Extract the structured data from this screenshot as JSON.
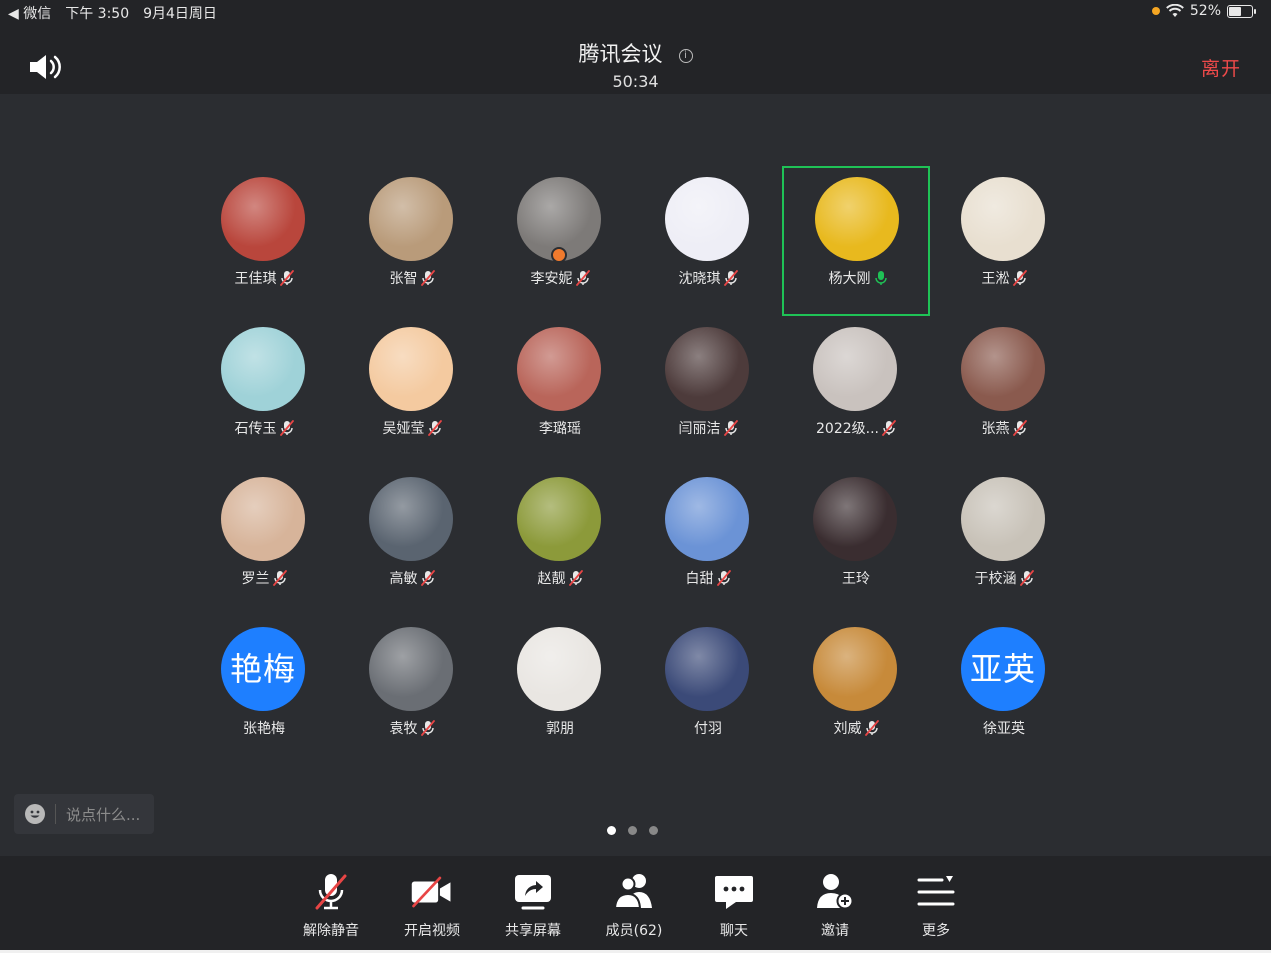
{
  "status_bar": {
    "back_app": "◀ 微信",
    "time": "下午 3:50",
    "date": "9月4日周日",
    "battery": "52%"
  },
  "header": {
    "title": "腾讯会议",
    "info_icon": "i",
    "timer": "50:34",
    "leave_label": "离开"
  },
  "participants": [
    {
      "name": "王佳琪",
      "mic": "muted",
      "avatar": "photo",
      "color": "#b9463c"
    },
    {
      "name": "张智",
      "mic": "muted",
      "avatar": "photo",
      "color": "#b99b7a"
    },
    {
      "name": "李安妮",
      "mic": "muted",
      "avatar": "photo",
      "color": "#7d7a78"
    },
    {
      "name": "沈晓琪",
      "mic": "muted",
      "avatar": "photo",
      "color": "#eeeef6"
    },
    {
      "name": "杨大刚",
      "mic": "active",
      "avatar": "photo",
      "color": "#e8b91e"
    },
    {
      "name": "王淞",
      "mic": "muted",
      "avatar": "photo",
      "color": "#e8dfd0"
    },
    {
      "name": "石传玉",
      "mic": "muted",
      "avatar": "photo",
      "color": "#9fd2d8"
    },
    {
      "name": "吴娅莹",
      "mic": "muted",
      "avatar": "photo",
      "color": "#f4caa0"
    },
    {
      "name": "李璐瑶",
      "mic": "none",
      "avatar": "photo",
      "color": "#b9655a"
    },
    {
      "name": "闫丽洁",
      "mic": "muted",
      "avatar": "photo",
      "color": "#4d3b3b"
    },
    {
      "name": "2022级...",
      "mic": "muted",
      "avatar": "photo",
      "color": "#c9c2be"
    },
    {
      "name": "张燕",
      "mic": "muted",
      "avatar": "photo",
      "color": "#8a5a4e"
    },
    {
      "name": "罗兰",
      "mic": "muted",
      "avatar": "photo",
      "color": "#d7b49a"
    },
    {
      "name": "高敏",
      "mic": "muted",
      "avatar": "photo",
      "color": "#5a6470"
    },
    {
      "name": "赵靓",
      "mic": "muted",
      "avatar": "photo",
      "color": "#8c9a3a"
    },
    {
      "name": "白甜",
      "mic": "muted",
      "avatar": "photo",
      "color": "#6b93d6"
    },
    {
      "name": "王玲",
      "mic": "none",
      "avatar": "photo",
      "color": "#3a2d30"
    },
    {
      "name": "于校涵",
      "mic": "muted",
      "avatar": "photo",
      "color": "#c8c2b8"
    },
    {
      "name": "张艳梅",
      "mic": "none",
      "avatar": "text",
      "avatar_text": "艳梅"
    },
    {
      "name": "袁牧",
      "mic": "muted",
      "avatar": "photo",
      "color": "#6a6e74"
    },
    {
      "name": "郭朋",
      "mic": "none",
      "avatar": "photo",
      "color": "#e9e6e2"
    },
    {
      "name": "付羽",
      "mic": "none",
      "avatar": "photo",
      "color": "#3b4a78"
    },
    {
      "name": "刘威",
      "mic": "muted",
      "avatar": "photo",
      "color": "#c78a3a"
    },
    {
      "name": "徐亚英",
      "mic": "none",
      "avatar": "text",
      "avatar_text": "亚英"
    }
  ],
  "active_speaker_index": 4,
  "chat": {
    "placeholder": "说点什么..."
  },
  "pagination": {
    "total": 3,
    "current": 0
  },
  "toolbar": {
    "unmute_label": "解除静音",
    "video_label": "开启视频",
    "share_label": "共享屏幕",
    "members_label": "成员(62)",
    "chat_label": "聊天",
    "invite_label": "邀请",
    "more_label": "更多"
  },
  "colors": {
    "background": "#2b2d31",
    "bar": "#232427",
    "accent_green": "#1fc256",
    "leave_red": "#ee4a4a",
    "avatar_blue": "#1e7fff"
  }
}
